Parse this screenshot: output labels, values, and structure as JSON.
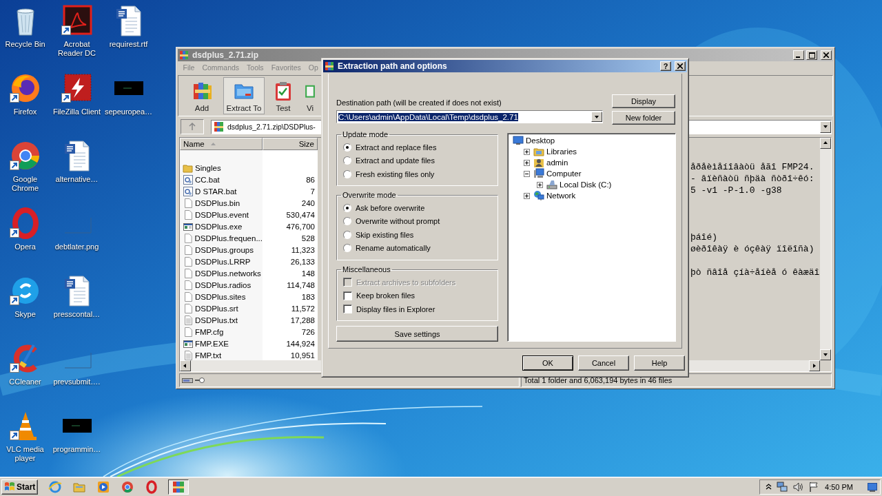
{
  "desktop": {
    "icons": [
      {
        "label": "Recycle Bin",
        "kind": "recycle",
        "shortcut": false
      },
      {
        "label": "Firefox",
        "kind": "firefox",
        "shortcut": true
      },
      {
        "label": "Google Chrome",
        "kind": "chrome",
        "shortcut": true
      },
      {
        "label": "Opera",
        "kind": "opera",
        "shortcut": true
      },
      {
        "label": "Skype",
        "kind": "skype",
        "shortcut": true
      },
      {
        "label": "CCleaner",
        "kind": "ccleaner",
        "shortcut": true
      },
      {
        "label": "VLC media player",
        "kind": "vlc",
        "shortcut": true
      },
      {
        "label": "Acrobat Reader DC",
        "kind": "acrobat",
        "shortcut": true
      },
      {
        "label": "FileZilla Client",
        "kind": "filezilla",
        "shortcut": true
      },
      {
        "label": "alternative…",
        "kind": "word",
        "shortcut": false
      },
      {
        "label": "debtlater.png",
        "kind": "image-blank",
        "shortcut": false
      },
      {
        "label": "presscontal…",
        "kind": "word",
        "shortcut": false
      },
      {
        "label": "prevsubmit….",
        "kind": "image-blank",
        "shortcut": false
      },
      {
        "label": "programmin…",
        "kind": "image-dark",
        "shortcut": false
      },
      {
        "label": "requirest.rtf",
        "kind": "word",
        "shortcut": false
      },
      {
        "label": "sepeuropea…",
        "kind": "image-dark",
        "shortcut": false
      }
    ]
  },
  "archive_window": {
    "title": "dsdplus_2.71.zip",
    "menu": [
      "File",
      "Commands",
      "Tools",
      "Favorites",
      "Op"
    ],
    "toolbar": [
      {
        "label": "Add",
        "kind": "add",
        "pressed": false
      },
      {
        "label": "Extract To",
        "kind": "extract",
        "pressed": true
      },
      {
        "label": "Test",
        "kind": "test",
        "pressed": false
      },
      {
        "label": "Vi",
        "kind": "view",
        "pressed": false
      }
    ],
    "path": "dsdplus_2.71.zip\\DSDPlus-",
    "columns": [
      {
        "label": "Name",
        "sorted": true
      },
      {
        "label": "Size",
        "sorted": false
      }
    ],
    "files": [
      {
        "name": "Singles",
        "kind": "folder"
      },
      {
        "name": "CC.bat",
        "size": "86",
        "kind": "script"
      },
      {
        "name": "D STAR.bat",
        "size": "7",
        "kind": "script"
      },
      {
        "name": "DSDPlus.bin",
        "size": "240",
        "kind": "file"
      },
      {
        "name": "DSDPlus.event",
        "size": "530,474",
        "kind": "file"
      },
      {
        "name": "DSDPlus.exe",
        "size": "476,700",
        "kind": "program"
      },
      {
        "name": "DSDPlus.frequen...",
        "size": "528",
        "kind": "file"
      },
      {
        "name": "DSDPlus.groups",
        "size": "11,323",
        "kind": "file"
      },
      {
        "name": "DSDPlus.LRRP",
        "size": "26,133",
        "kind": "file"
      },
      {
        "name": "DSDPlus.networks",
        "size": "148",
        "kind": "file"
      },
      {
        "name": "DSDPlus.radios",
        "size": "114,748",
        "kind": "file"
      },
      {
        "name": "DSDPlus.sites",
        "size": "183",
        "kind": "file"
      },
      {
        "name": "DSDPlus.srt",
        "size": "11,572",
        "kind": "file"
      },
      {
        "name": "DSDPlus.txt",
        "size": "17,288",
        "kind": "text"
      },
      {
        "name": "FMP.cfg",
        "size": "726",
        "kind": "file"
      },
      {
        "name": "FMP.EXE",
        "size": "144,924",
        "kind": "program"
      },
      {
        "name": "FMP.txt",
        "size": "10,951",
        "kind": "text"
      }
    ],
    "preview": [
      [
        "åðåèìåíîâàòü åãî FMP24.",
        "- âïèñàòü ñþäà ñòðî÷êó:",
        "5 -v1 -P-1.0 -g38"
      ],
      [
        "þáîé)",
        "øèðîêàÿ è óçêàÿ ïîëîñà)"
      ],
      [
        "þò ñâîå çíà÷åíèå ó êàæäî"
      ]
    ],
    "status": "Total 1 folder and 6,063,194 bytes in 46 files"
  },
  "dialog": {
    "title": "Extraction path and options",
    "help_glyph": "?",
    "path_label": "Destination path (will be created if does not exist)",
    "path_value": "C:\\Users\\admin\\AppData\\Local\\Temp\\dsdplus_2.71",
    "side_buttons": [
      "Display",
      "New folder"
    ],
    "groups": [
      {
        "title": "Update mode",
        "kind": "radio",
        "options": [
          {
            "label": "Extract and replace files",
            "selected": true
          },
          {
            "label": "Extract and update files",
            "selected": false
          },
          {
            "label": "Fresh existing files only",
            "selected": false
          }
        ]
      },
      {
        "title": "Overwrite mode",
        "kind": "radio",
        "options": [
          {
            "label": "Ask before overwrite",
            "selected": true
          },
          {
            "label": "Overwrite without prompt",
            "selected": false
          },
          {
            "label": "Skip existing files",
            "selected": false
          },
          {
            "label": "Rename automatically",
            "selected": false
          }
        ]
      },
      {
        "title": "Miscellaneous",
        "kind": "checkbox",
        "options": [
          {
            "label": "Extract archives to subfolders",
            "checked": false,
            "disabled": true
          },
          {
            "label": "Keep broken files",
            "checked": false,
            "disabled": false
          },
          {
            "label": "Display files in Explorer",
            "checked": false,
            "disabled": false
          }
        ]
      }
    ],
    "save_button": "Save settings",
    "tree": [
      {
        "label": "Desktop",
        "kind": "desktop",
        "children": [
          {
            "label": "Libraries",
            "kind": "libraries",
            "expanded": false
          },
          {
            "label": "admin",
            "kind": "user",
            "expanded": false
          },
          {
            "label": "Computer",
            "kind": "computer",
            "expanded": true,
            "children": [
              {
                "label": "Local Disk (C:)",
                "kind": "disk",
                "expanded": false
              }
            ]
          },
          {
            "label": "Network",
            "kind": "network",
            "expanded": false
          }
        ]
      }
    ],
    "buttons": [
      {
        "label": "OK",
        "default": true
      },
      {
        "label": "Cancel",
        "default": false
      },
      {
        "label": "Help",
        "default": false
      }
    ]
  },
  "taskbar": {
    "start": "Start",
    "apps": [
      {
        "kind": "ie",
        "active": false
      },
      {
        "kind": "explorer",
        "active": false
      },
      {
        "kind": "media",
        "active": false
      },
      {
        "kind": "chrome",
        "active": false
      },
      {
        "kind": "opera",
        "active": false
      },
      {
        "kind": "winrar",
        "active": true
      }
    ],
    "clock": "4:50 PM"
  }
}
